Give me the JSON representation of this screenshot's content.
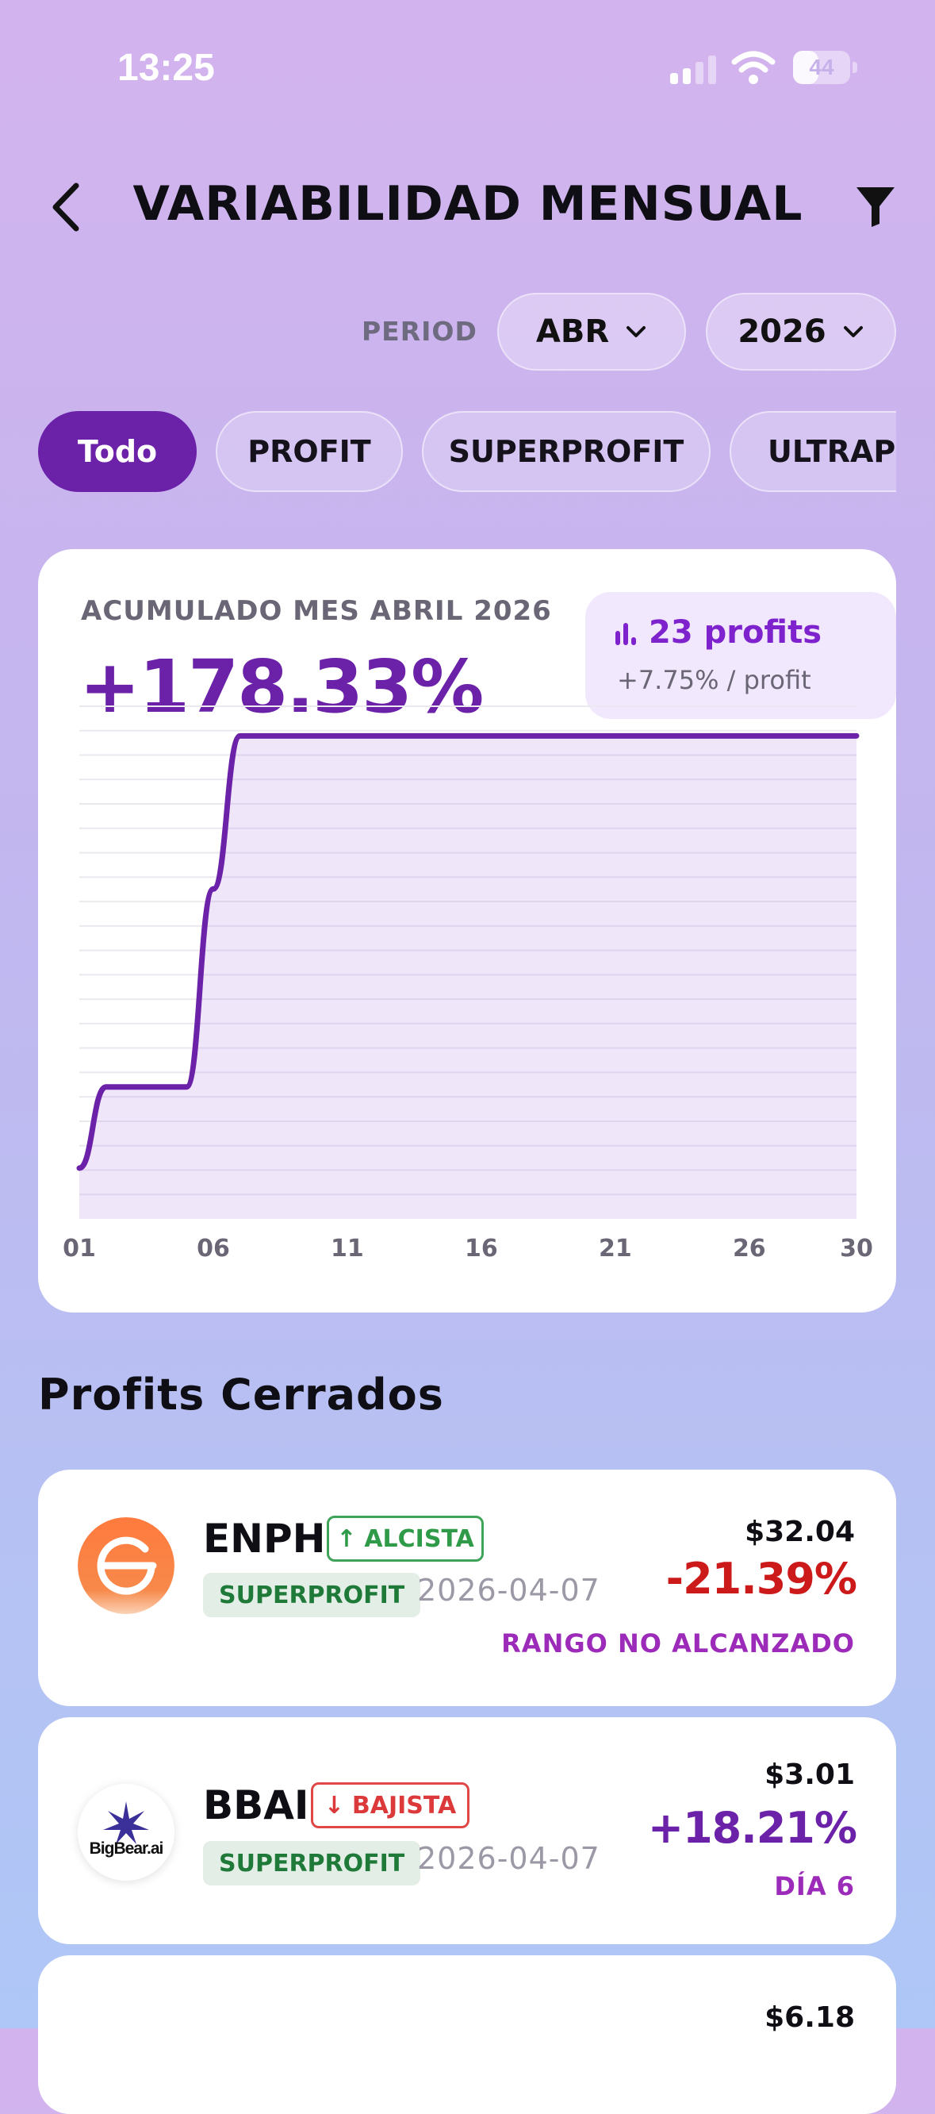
{
  "status_bar": {
    "time": "13:25",
    "battery": "44",
    "battery_level": 0.44
  },
  "header": {
    "title": "VARIABILIDAD MENSUAL"
  },
  "period": {
    "label": "PERIOD",
    "month": "ABR",
    "year": "2026"
  },
  "filters": [
    {
      "label": "Todo",
      "active": true
    },
    {
      "label": "PROFIT",
      "active": false
    },
    {
      "label": "SUPERPROFIT",
      "active": false
    },
    {
      "label": "ULTRAPROFIT",
      "active": false
    }
  ],
  "summary": {
    "label": "ACUMULADO MES ABRIL 2026",
    "value": "+178.33%",
    "profits_count": "23 profits",
    "per_profit": "+7.75% / profit"
  },
  "chart_data": {
    "type": "area",
    "x": [
      1,
      2,
      3,
      4,
      5,
      6,
      7,
      8,
      30
    ],
    "y": [
      8,
      40,
      40,
      40,
      40,
      118,
      178.33,
      178.33,
      178.33
    ],
    "xticks": [
      "01",
      "06",
      "11",
      "16",
      "21",
      "26",
      "30"
    ],
    "xlim": [
      1,
      30
    ],
    "ylim": [
      -12,
      190
    ],
    "color": "#6b21a8",
    "grid": true
  },
  "section_title": "Profits Cerrados",
  "profits": [
    {
      "ticker": "ENPH",
      "trend": "ALCISTA",
      "trend_dir": "up",
      "type": "SUPERPROFIT",
      "date": "2026-04-07",
      "price": "$32.04",
      "pct": "-21.39%",
      "note": "RANGO NO ALCANZADO"
    },
    {
      "ticker": "BBAI",
      "trend": "BAJISTA",
      "trend_dir": "down",
      "type": "SUPERPROFIT",
      "date": "2026-04-07",
      "price": "$3.01",
      "pct": "+18.21%",
      "note": "DÍA 6",
      "logo_text": "BigBear.ai"
    },
    {
      "price": "$6.18"
    }
  ]
}
